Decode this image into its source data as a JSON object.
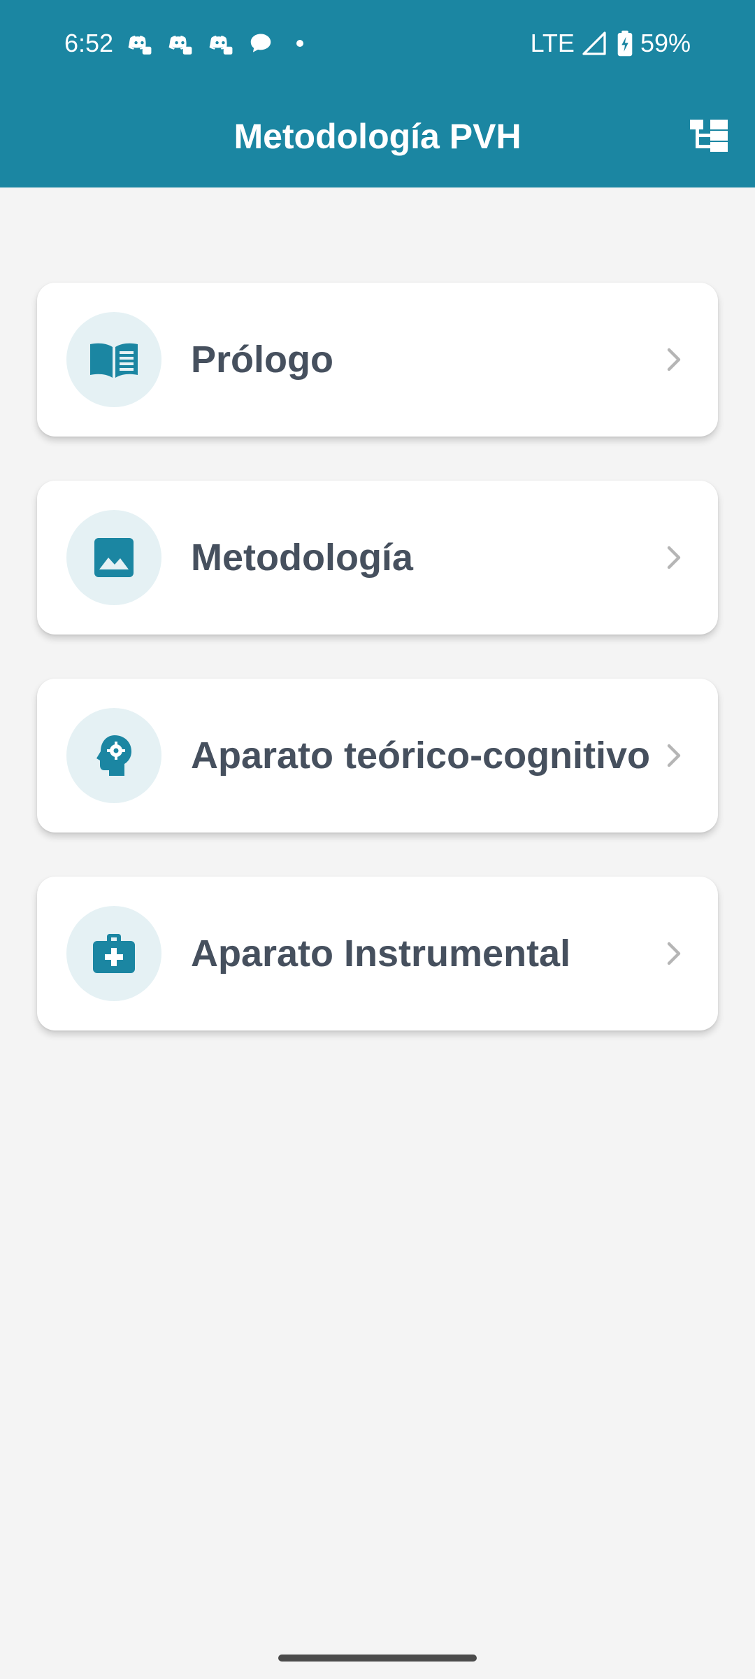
{
  "status_bar": {
    "time": "6:52",
    "network": "LTE",
    "battery": "59%",
    "notification_icons": [
      "discord-icon",
      "discord-icon",
      "discord-icon",
      "chat-bubble-icon"
    ]
  },
  "app_bar": {
    "title": "Metodología PVH",
    "action_icon": "sitemap-icon",
    "color": "#1b86a2"
  },
  "menu": {
    "items": [
      {
        "label": "Prólogo",
        "icon": "book-icon"
      },
      {
        "label": "Metodología",
        "icon": "image-icon"
      },
      {
        "label": "Aparato teórico-cognitivo",
        "icon": "head-gear-icon"
      },
      {
        "label": "Aparato Instrumental",
        "icon": "medical-kit-icon"
      }
    ]
  },
  "colors": {
    "accent": "#1b86a2",
    "icon_circle": "#e5f1f4",
    "label_text": "#46505e",
    "background": "#f4f4f4",
    "chevron": "#b5b5b5"
  }
}
